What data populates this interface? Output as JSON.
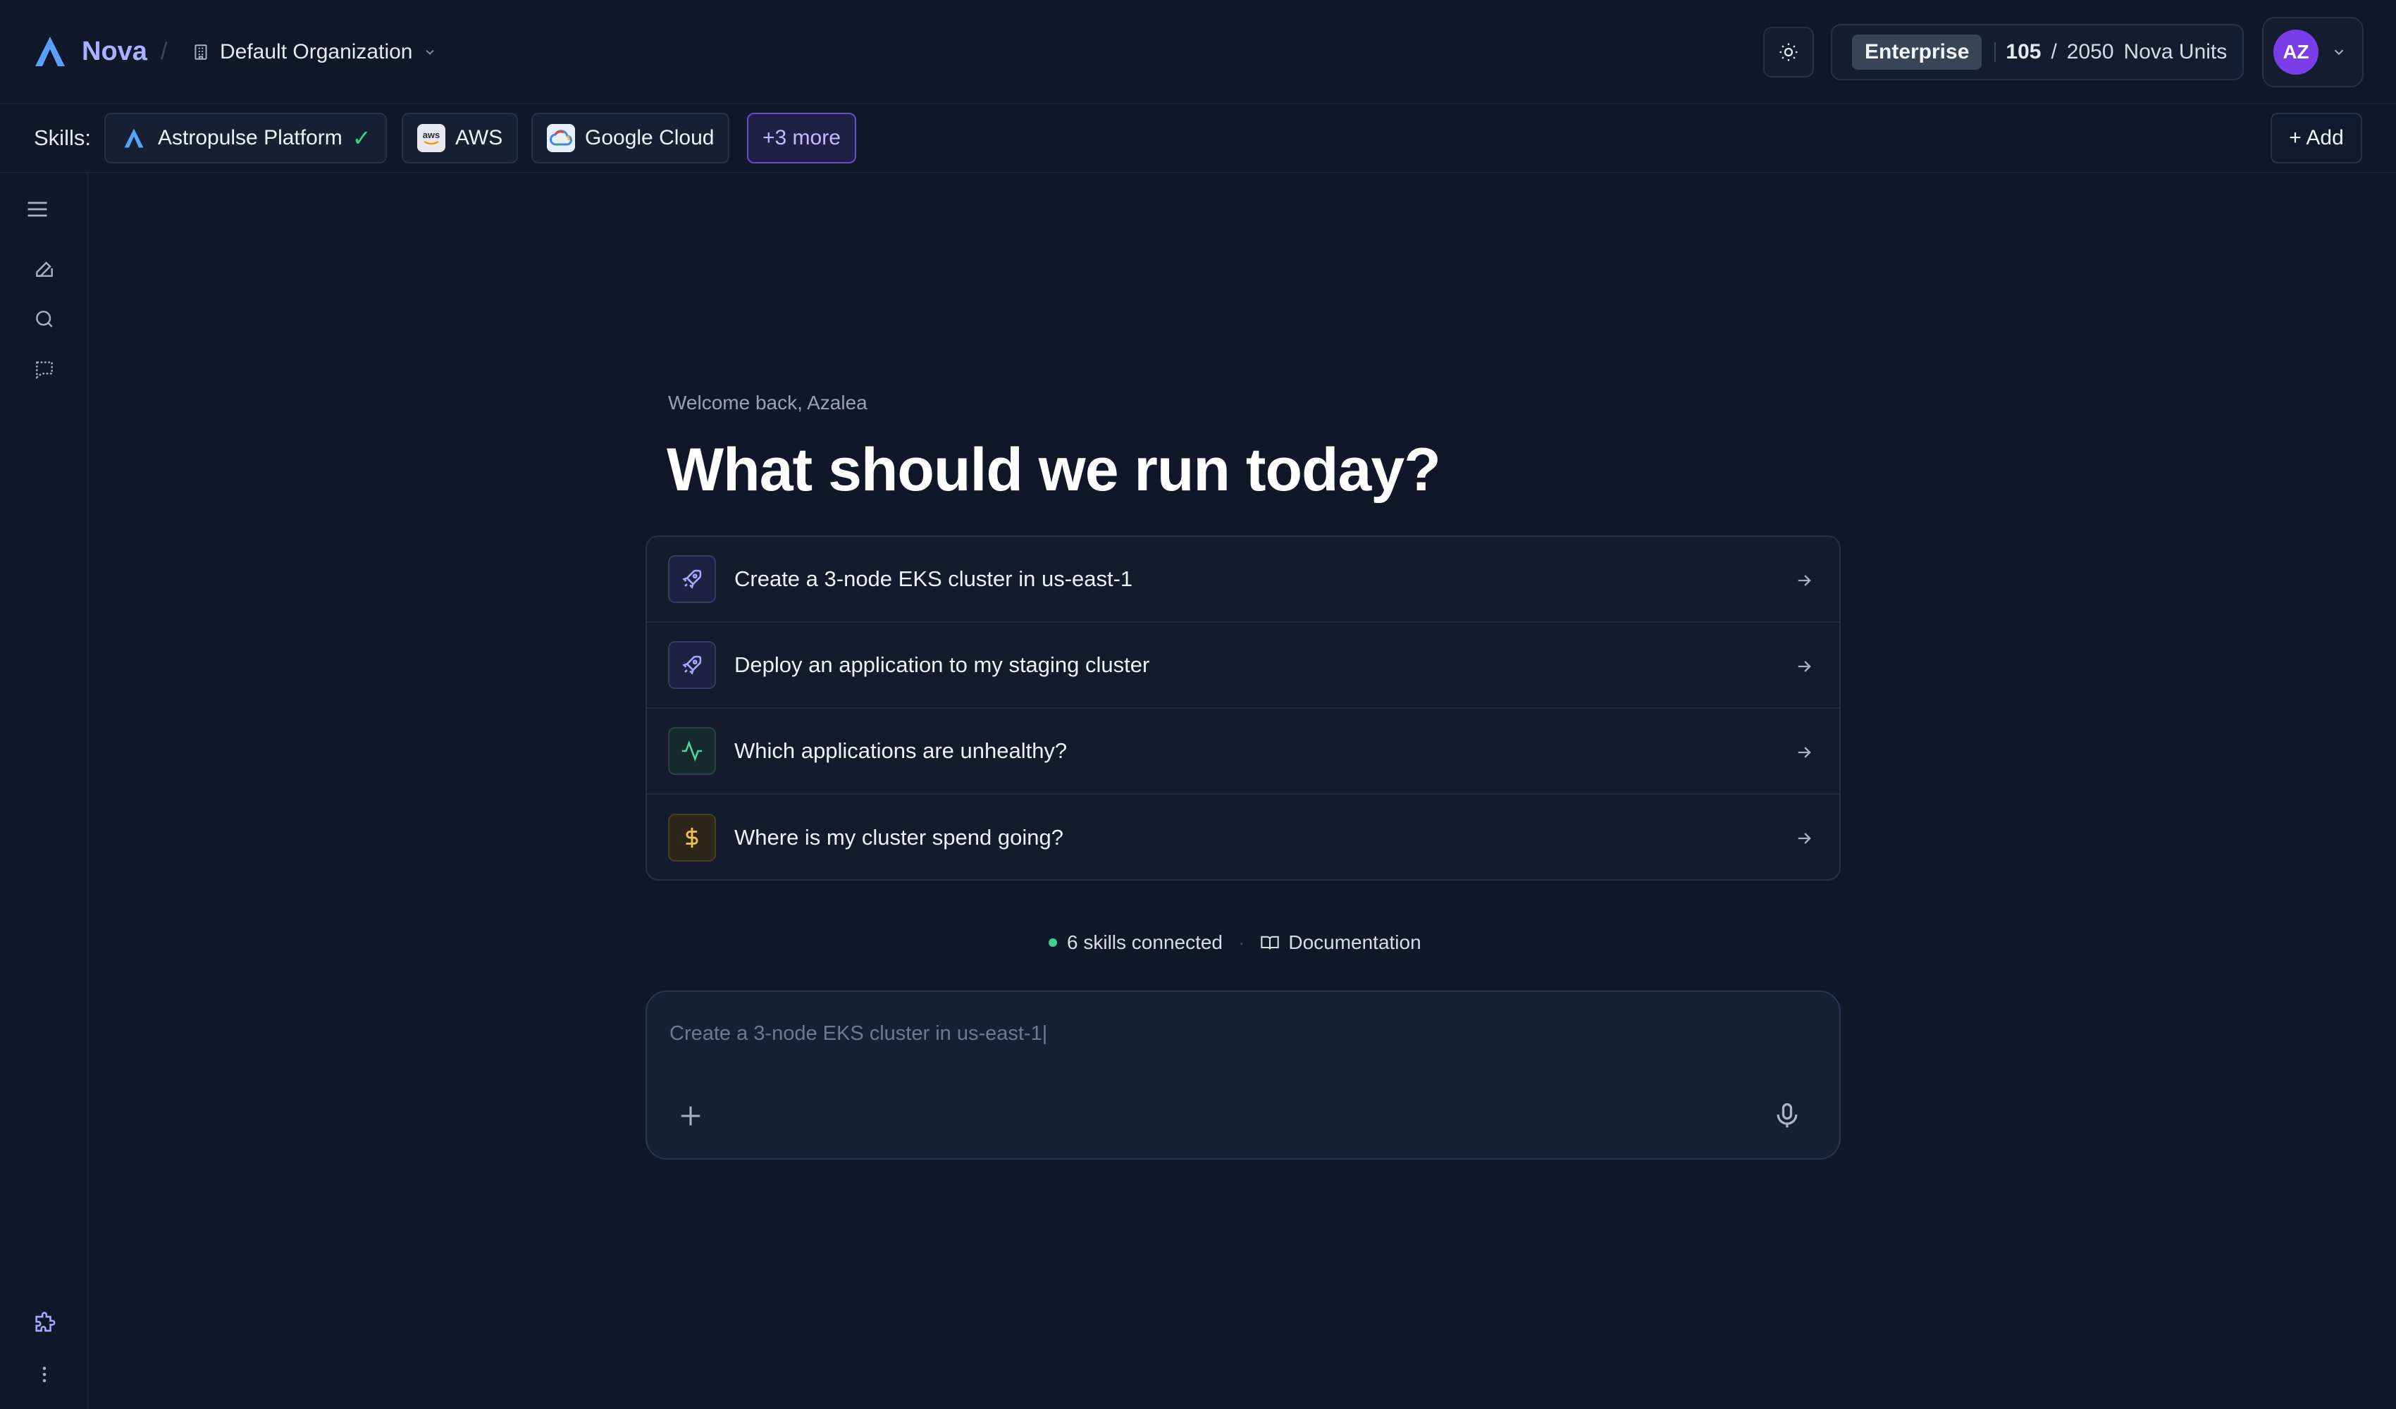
{
  "header": {
    "brand": "Nova",
    "separator": "/",
    "org_name": "Default Organization",
    "plan_badge": "Enterprise",
    "units_used": "105",
    "units_sep": "/",
    "units_total": "2050",
    "units_label": "Nova Units",
    "avatar_initials": "AZ"
  },
  "skills": {
    "label": "Skills:",
    "chips": [
      {
        "label": "Astropulse Platform",
        "icon": "astropulse-logo",
        "connected_mark": "✓"
      },
      {
        "label": "AWS",
        "icon": "aws-logo"
      },
      {
        "label": "Google Cloud",
        "icon": "google-cloud-logo"
      }
    ],
    "more_label": "+3 more",
    "add_label": "+ Add"
  },
  "sidebar": {
    "icons": [
      "menu-icon",
      "new-chat-icon",
      "search-icon",
      "chats-icon",
      "puzzle-icon",
      "more-vertical-icon"
    ]
  },
  "main": {
    "welcome": "Welcome back, Azalea",
    "headline": "What should we run today?",
    "suggestions": [
      {
        "label": "Create a 3-node EKS cluster in us-east-1",
        "icon": "rocket-icon"
      },
      {
        "label": "Deploy an application to my staging cluster",
        "icon": "rocket-icon"
      },
      {
        "label": "Which applications are unhealthy?",
        "icon": "activity-icon"
      },
      {
        "label": "Where is my cluster spend going?",
        "icon": "dollar-icon"
      }
    ],
    "status_text": "6 skills connected",
    "status_separator": "·",
    "docs_label": "Documentation"
  },
  "composer": {
    "placeholder": "Create a 3-node EKS cluster in us-east-1|"
  },
  "colors": {
    "background": "#0f1729",
    "accent_purple": "#7a3ee8",
    "brand_text": "#a9b0ff",
    "status_green": "#3fcf8e"
  }
}
